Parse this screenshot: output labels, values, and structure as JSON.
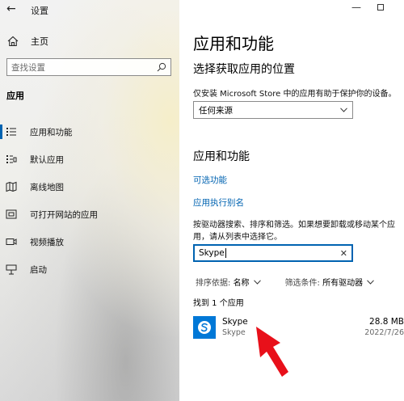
{
  "window": {
    "title": "设置",
    "back_icon": "back-arrow-icon",
    "minimize_icon": "minimize-icon",
    "maximize_icon": "maximize-icon"
  },
  "sidebar": {
    "home_label": "主页",
    "home_icon": "home-icon",
    "search_placeholder": "查找设置",
    "search_icon": "search-icon",
    "section_title": "应用",
    "items": [
      {
        "label": "应用和功能",
        "icon": "apps-features-icon",
        "active": true
      },
      {
        "label": "默认应用",
        "icon": "default-apps-icon",
        "active": false
      },
      {
        "label": "离线地图",
        "icon": "offline-maps-icon",
        "active": false
      },
      {
        "label": "可打开网站的应用",
        "icon": "apps-for-websites-icon",
        "active": false
      },
      {
        "label": "视频播放",
        "icon": "video-playback-icon",
        "active": false
      },
      {
        "label": "启动",
        "icon": "startup-icon",
        "active": false
      }
    ]
  },
  "main": {
    "page_title": "应用和功能",
    "install_heading": "选择获取应用的位置",
    "install_description": "仅安装 Microsoft Store 中的应用有助于保护你的设备。",
    "install_source_value": "任何来源",
    "apps_heading": "应用和功能",
    "optional_features_link": "可选功能",
    "app_aliases_link": "应用执行别名",
    "search_description": "按驱动器搜索、排序和筛选。如果想要卸载或移动某个应用，请从列表中选择它。",
    "filter_value": "Skype",
    "sort_label": "排序依据:",
    "sort_value": "名称",
    "drive_filter_label": "筛选条件:",
    "drive_filter_value": "所有驱动器",
    "results_count": "找到 1 个应用",
    "apps": [
      {
        "name": "Skype",
        "publisher": "Skype",
        "size": "28.8 MB",
        "date": "2022/7/26",
        "icon": "skype-icon"
      }
    ]
  },
  "colors": {
    "accent": "#0063b1",
    "skype_blue": "#0078d7",
    "annotation_red": "#e8101a"
  },
  "annotation": {
    "icon": "red-arrow-pointer-icon"
  }
}
